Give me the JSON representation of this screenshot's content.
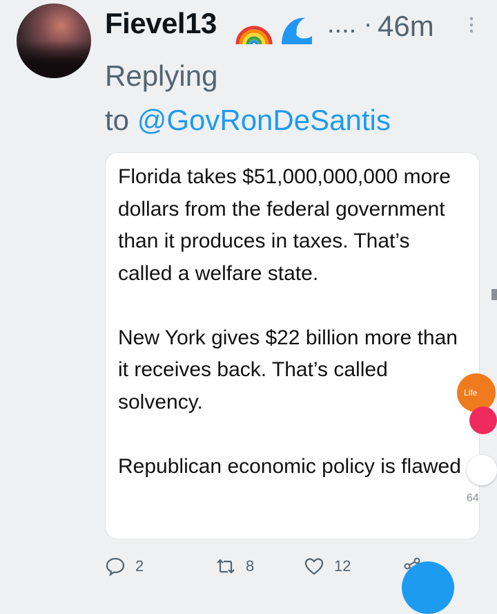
{
  "tweet": {
    "username": "Fievel13",
    "emojis": [
      "rainbow-emoji",
      "wave-emoji"
    ],
    "ellipsis": "....",
    "separator": "·",
    "time": "46m",
    "replying_prefix": "Replying",
    "replying_to_word": "to",
    "replying_handle": "@GovRonDeSantis",
    "image_text": [
      "Florida takes $51,000,000,000 more dollars from the federal government than it produces in taxes.  That’s called a welfare state.",
      "New York gives $22 billion more than it receives back.  That’s called solvency.",
      "Republican economic policy is flawed"
    ]
  },
  "actions": {
    "reply_count": "2",
    "retweet_count": "8",
    "like_count": "12"
  },
  "overlay": {
    "orange_label": "Life",
    "white_count": "64"
  },
  "colors": {
    "background": "#eef0f2",
    "text": "#0f1419",
    "muted": "#536471",
    "accent": "#1d9bf0"
  }
}
